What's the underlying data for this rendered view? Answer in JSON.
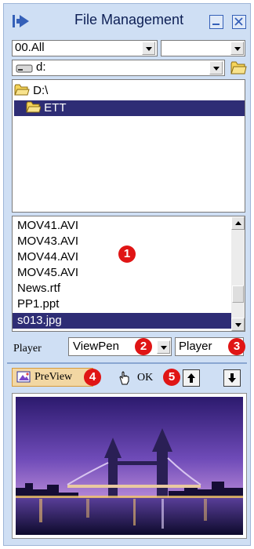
{
  "window": {
    "title": "File Management"
  },
  "filter_combo": {
    "value": "00.All",
    "secondary_value": ""
  },
  "drive_combo": {
    "value": "d:"
  },
  "tree": {
    "items": [
      {
        "label": "D:\\"
      },
      {
        "label": "ETT",
        "selected": true
      }
    ]
  },
  "files": {
    "items": [
      {
        "name": "MOV41.AVI"
      },
      {
        "name": "MOV43.AVI"
      },
      {
        "name": "MOV44.AVI"
      },
      {
        "name": "MOV45.AVI"
      },
      {
        "name": "News.rtf"
      },
      {
        "name": "PP1.ppt"
      },
      {
        "name": "s013.jpg",
        "selected": true
      }
    ]
  },
  "player": {
    "label": "Player",
    "viewer_value": "ViewPen",
    "player_button": "Player"
  },
  "toolbar": {
    "preview_label": "PreView",
    "ok_label": "OK"
  },
  "callouts": [
    "1",
    "2",
    "3",
    "4",
    "5"
  ],
  "colors": {
    "panel_bg": "#cfdff4",
    "selection": "#2e2d75",
    "callout": "#e01515",
    "preview_btn_bg": "#f2d7a3"
  }
}
